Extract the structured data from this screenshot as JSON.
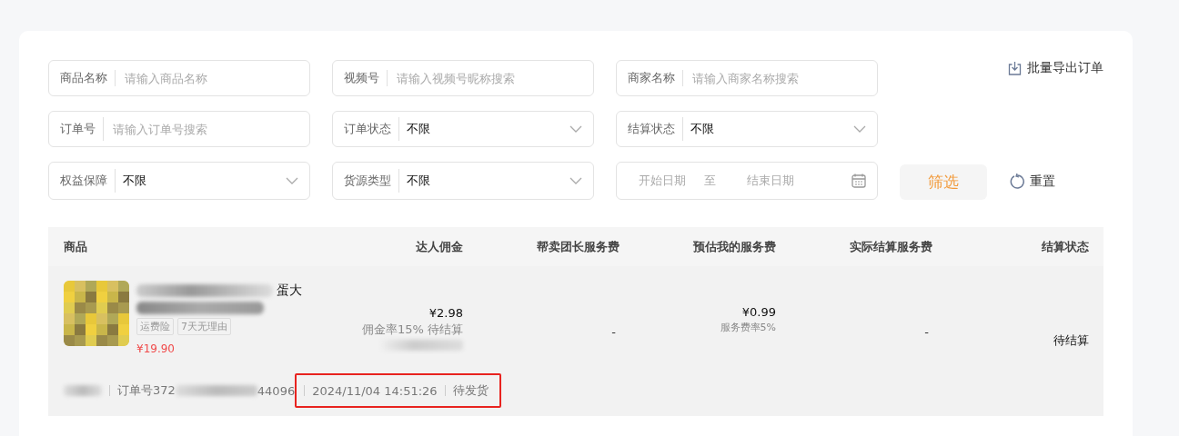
{
  "filters": [
    {
      "kind": "text",
      "label": "商品名称",
      "placeholder": "请输入商品名称"
    },
    {
      "kind": "text",
      "label": "视频号",
      "placeholder": "请输入视频号昵称搜索"
    },
    {
      "kind": "text",
      "label": "商家名称",
      "placeholder": "请输入商家名称搜索"
    },
    {
      "kind": "text",
      "label": "订单号",
      "placeholder": "请输入订单号搜索"
    },
    {
      "kind": "select",
      "label": "订单状态",
      "value": "不限"
    },
    {
      "kind": "select",
      "label": "结算状态",
      "value": "不限"
    },
    {
      "kind": "select",
      "label": "权益保障",
      "value": "不限"
    },
    {
      "kind": "select",
      "label": "货源类型",
      "value": "不限"
    },
    {
      "kind": "daterange",
      "start_placeholder": "开始日期",
      "separator": "至",
      "end_placeholder": "结束日期"
    }
  ],
  "export_button": "批量导出订单",
  "filter_button": "筛选",
  "reset_button": "重置",
  "table": {
    "columns": [
      "商品",
      "达人佣金",
      "帮卖团长服务费",
      "预估我的服务费",
      "实际结算服务费",
      "结算状态"
    ],
    "rows": [
      {
        "title": "蛋大",
        "tags": [
          "运费险",
          "7天无理由"
        ],
        "price": "¥19.90",
        "commission": "¥2.98",
        "commission_note": "佣金率15% 待结算",
        "leader_fee": "-",
        "my_fee": "¥0.99",
        "my_fee_note": "服务费率5%",
        "actual_fee": "-",
        "settle_status": "待结算",
        "order_label": "订单号372",
        "order_tail": "44096",
        "time": "2024/11/04 14:51:26",
        "order_status": "待发货",
        "highlighted": true
      }
    ]
  }
}
